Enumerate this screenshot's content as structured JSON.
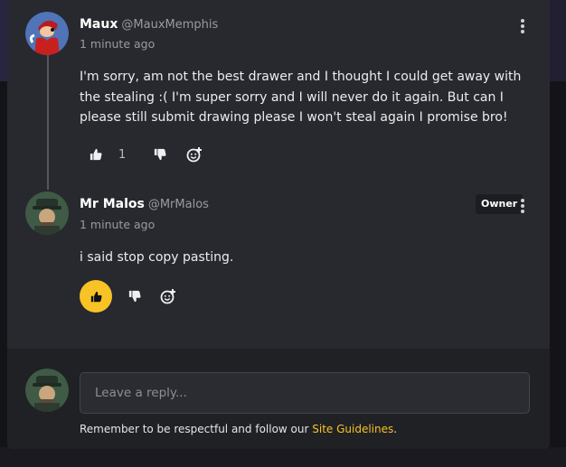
{
  "comments": [
    {
      "name": "Maux",
      "handle": "@MauxMemphis",
      "time": "1 minute ago",
      "body": "I'm sorry, am not the best drawer and I thought I could get away with the stealing :( I'm super sorry and I will never do it again. But can I please still submit drawing please I won't steal again I promise bro!",
      "like_count": "1"
    },
    {
      "name": "Mr Malos",
      "handle": "@MrMalos",
      "badge": "Owner",
      "time": "1 minute ago",
      "body": "i said stop copy pasting."
    }
  ],
  "reply": {
    "placeholder": "Leave a reply...",
    "note_prefix": "Remember to be respectful and follow our ",
    "note_link": "Site Guidelines",
    "note_suffix": "."
  },
  "colors": {
    "accent": "#f7c325",
    "panel": "#28292e",
    "reply_bg": "#202125"
  }
}
